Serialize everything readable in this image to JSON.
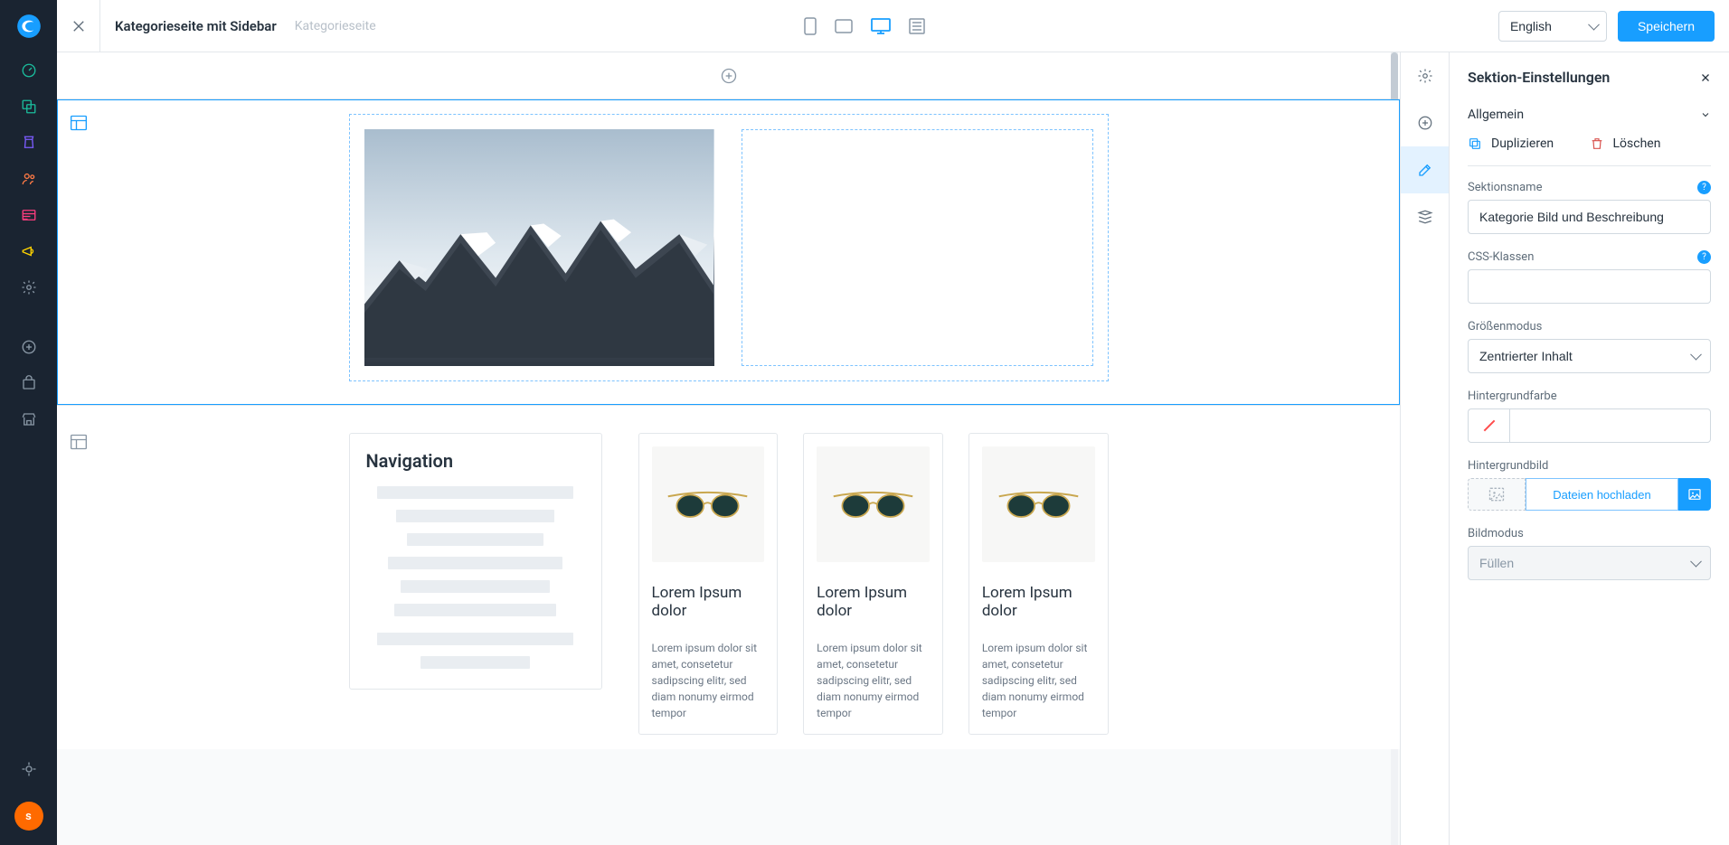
{
  "mainnav": {
    "avatar_initial": "s"
  },
  "topbar": {
    "title": "Kategorieseite mit Sidebar",
    "subtitle": "Kategorieseite",
    "language": "English",
    "save_label": "Speichern"
  },
  "canvas": {
    "section2": {
      "nav_heading": "Navigation",
      "products": [
        {
          "title": "Lorem Ipsum dolor",
          "desc": "Lorem ipsum dolor sit amet, consetetur sadipscing elitr, sed diam nonumy eirmod tempor"
        },
        {
          "title": "Lorem Ipsum dolor",
          "desc": "Lorem ipsum dolor sit amet, consetetur sadipscing elitr, sed diam nonumy eirmod tempor"
        },
        {
          "title": "Lorem Ipsum dolor",
          "desc": "Lorem ipsum dolor sit amet, consetetur sadipscing elitr, sed diam nonumy eirmod tempor"
        }
      ]
    }
  },
  "panel": {
    "title": "Sektion-Einstellungen",
    "accordion_label": "Allgemein",
    "duplicate_label": "Duplizieren",
    "delete_label": "Löschen",
    "fields": {
      "section_name_label": "Sektionsname",
      "section_name_value": "Kategorie Bild und Beschreibung",
      "css_classes_label": "CSS-Klassen",
      "css_classes_value": "",
      "size_mode_label": "Größenmodus",
      "size_mode_value": "Zentrierter Inhalt",
      "bg_color_label": "Hintergrundfarbe",
      "bg_color_value": "",
      "bg_image_label": "Hintergrundbild",
      "upload_button_label": "Dateien hochladen",
      "image_mode_label": "Bildmodus",
      "image_mode_value": "Füllen"
    }
  }
}
